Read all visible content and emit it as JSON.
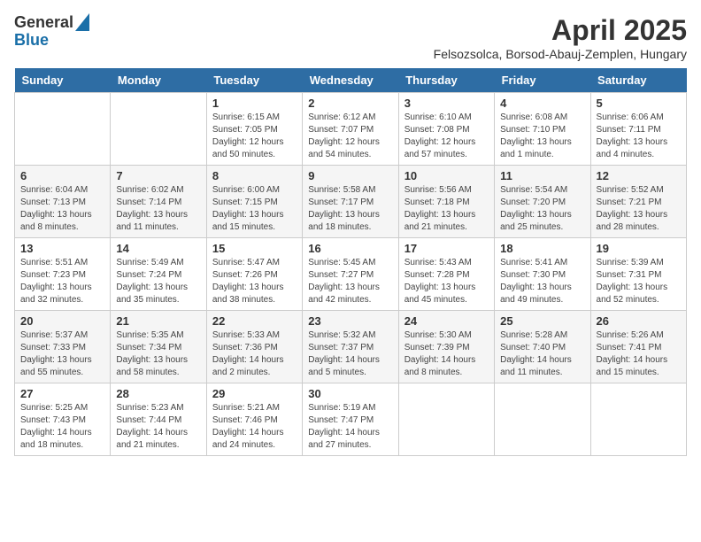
{
  "header": {
    "logo_general": "General",
    "logo_blue": "Blue",
    "title": "April 2025",
    "subtitle": "Felsozsolca, Borsod-Abauj-Zemplen, Hungary"
  },
  "calendar": {
    "days_of_week": [
      "Sunday",
      "Monday",
      "Tuesday",
      "Wednesday",
      "Thursday",
      "Friday",
      "Saturday"
    ],
    "weeks": [
      [
        {
          "day": "",
          "sunrise": "",
          "sunset": "",
          "daylight": ""
        },
        {
          "day": "",
          "sunrise": "",
          "sunset": "",
          "daylight": ""
        },
        {
          "day": "1",
          "sunrise": "Sunrise: 6:15 AM",
          "sunset": "Sunset: 7:05 PM",
          "daylight": "Daylight: 12 hours and 50 minutes."
        },
        {
          "day": "2",
          "sunrise": "Sunrise: 6:12 AM",
          "sunset": "Sunset: 7:07 PM",
          "daylight": "Daylight: 12 hours and 54 minutes."
        },
        {
          "day": "3",
          "sunrise": "Sunrise: 6:10 AM",
          "sunset": "Sunset: 7:08 PM",
          "daylight": "Daylight: 12 hours and 57 minutes."
        },
        {
          "day": "4",
          "sunrise": "Sunrise: 6:08 AM",
          "sunset": "Sunset: 7:10 PM",
          "daylight": "Daylight: 13 hours and 1 minute."
        },
        {
          "day": "5",
          "sunrise": "Sunrise: 6:06 AM",
          "sunset": "Sunset: 7:11 PM",
          "daylight": "Daylight: 13 hours and 4 minutes."
        }
      ],
      [
        {
          "day": "6",
          "sunrise": "Sunrise: 6:04 AM",
          "sunset": "Sunset: 7:13 PM",
          "daylight": "Daylight: 13 hours and 8 minutes."
        },
        {
          "day": "7",
          "sunrise": "Sunrise: 6:02 AM",
          "sunset": "Sunset: 7:14 PM",
          "daylight": "Daylight: 13 hours and 11 minutes."
        },
        {
          "day": "8",
          "sunrise": "Sunrise: 6:00 AM",
          "sunset": "Sunset: 7:15 PM",
          "daylight": "Daylight: 13 hours and 15 minutes."
        },
        {
          "day": "9",
          "sunrise": "Sunrise: 5:58 AM",
          "sunset": "Sunset: 7:17 PM",
          "daylight": "Daylight: 13 hours and 18 minutes."
        },
        {
          "day": "10",
          "sunrise": "Sunrise: 5:56 AM",
          "sunset": "Sunset: 7:18 PM",
          "daylight": "Daylight: 13 hours and 21 minutes."
        },
        {
          "day": "11",
          "sunrise": "Sunrise: 5:54 AM",
          "sunset": "Sunset: 7:20 PM",
          "daylight": "Daylight: 13 hours and 25 minutes."
        },
        {
          "day": "12",
          "sunrise": "Sunrise: 5:52 AM",
          "sunset": "Sunset: 7:21 PM",
          "daylight": "Daylight: 13 hours and 28 minutes."
        }
      ],
      [
        {
          "day": "13",
          "sunrise": "Sunrise: 5:51 AM",
          "sunset": "Sunset: 7:23 PM",
          "daylight": "Daylight: 13 hours and 32 minutes."
        },
        {
          "day": "14",
          "sunrise": "Sunrise: 5:49 AM",
          "sunset": "Sunset: 7:24 PM",
          "daylight": "Daylight: 13 hours and 35 minutes."
        },
        {
          "day": "15",
          "sunrise": "Sunrise: 5:47 AM",
          "sunset": "Sunset: 7:26 PM",
          "daylight": "Daylight: 13 hours and 38 minutes."
        },
        {
          "day": "16",
          "sunrise": "Sunrise: 5:45 AM",
          "sunset": "Sunset: 7:27 PM",
          "daylight": "Daylight: 13 hours and 42 minutes."
        },
        {
          "day": "17",
          "sunrise": "Sunrise: 5:43 AM",
          "sunset": "Sunset: 7:28 PM",
          "daylight": "Daylight: 13 hours and 45 minutes."
        },
        {
          "day": "18",
          "sunrise": "Sunrise: 5:41 AM",
          "sunset": "Sunset: 7:30 PM",
          "daylight": "Daylight: 13 hours and 49 minutes."
        },
        {
          "day": "19",
          "sunrise": "Sunrise: 5:39 AM",
          "sunset": "Sunset: 7:31 PM",
          "daylight": "Daylight: 13 hours and 52 minutes."
        }
      ],
      [
        {
          "day": "20",
          "sunrise": "Sunrise: 5:37 AM",
          "sunset": "Sunset: 7:33 PM",
          "daylight": "Daylight: 13 hours and 55 minutes."
        },
        {
          "day": "21",
          "sunrise": "Sunrise: 5:35 AM",
          "sunset": "Sunset: 7:34 PM",
          "daylight": "Daylight: 13 hours and 58 minutes."
        },
        {
          "day": "22",
          "sunrise": "Sunrise: 5:33 AM",
          "sunset": "Sunset: 7:36 PM",
          "daylight": "Daylight: 14 hours and 2 minutes."
        },
        {
          "day": "23",
          "sunrise": "Sunrise: 5:32 AM",
          "sunset": "Sunset: 7:37 PM",
          "daylight": "Daylight: 14 hours and 5 minutes."
        },
        {
          "day": "24",
          "sunrise": "Sunrise: 5:30 AM",
          "sunset": "Sunset: 7:39 PM",
          "daylight": "Daylight: 14 hours and 8 minutes."
        },
        {
          "day": "25",
          "sunrise": "Sunrise: 5:28 AM",
          "sunset": "Sunset: 7:40 PM",
          "daylight": "Daylight: 14 hours and 11 minutes."
        },
        {
          "day": "26",
          "sunrise": "Sunrise: 5:26 AM",
          "sunset": "Sunset: 7:41 PM",
          "daylight": "Daylight: 14 hours and 15 minutes."
        }
      ],
      [
        {
          "day": "27",
          "sunrise": "Sunrise: 5:25 AM",
          "sunset": "Sunset: 7:43 PM",
          "daylight": "Daylight: 14 hours and 18 minutes."
        },
        {
          "day": "28",
          "sunrise": "Sunrise: 5:23 AM",
          "sunset": "Sunset: 7:44 PM",
          "daylight": "Daylight: 14 hours and 21 minutes."
        },
        {
          "day": "29",
          "sunrise": "Sunrise: 5:21 AM",
          "sunset": "Sunset: 7:46 PM",
          "daylight": "Daylight: 14 hours and 24 minutes."
        },
        {
          "day": "30",
          "sunrise": "Sunrise: 5:19 AM",
          "sunset": "Sunset: 7:47 PM",
          "daylight": "Daylight: 14 hours and 27 minutes."
        },
        {
          "day": "",
          "sunrise": "",
          "sunset": "",
          "daylight": ""
        },
        {
          "day": "",
          "sunrise": "",
          "sunset": "",
          "daylight": ""
        },
        {
          "day": "",
          "sunrise": "",
          "sunset": "",
          "daylight": ""
        }
      ]
    ]
  }
}
